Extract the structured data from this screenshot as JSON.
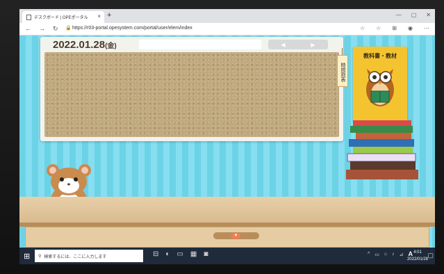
{
  "browser": {
    "tab_title": "デスクボード | OPEポータル",
    "tab_close": "×",
    "new_tab": "+",
    "window_controls": [
      "—",
      "▢",
      "✕"
    ],
    "nav_back": "←",
    "nav_forward": "→",
    "nav_refresh": "↻",
    "lock": "🔒",
    "url": "https://r03-portal.opesystem.com/portal/user/elem/index",
    "toolbar_icons": [
      "☆",
      "☆",
      "⊞",
      "◉",
      "⋯"
    ]
  },
  "page": {
    "date": "2022.01.28",
    "weekday": "(金)",
    "arrow_left": "◀",
    "arrow_right": "▶",
    "timetable_label": "時間割表",
    "textbook_label": "教科書・教材",
    "drawer_button": "▼"
  },
  "taskbar": {
    "start": "⊞",
    "search_icon": "⚲",
    "search_placeholder": "検索するには、ここに入力します",
    "apps": [
      "⊟",
      "◐",
      "▭",
      "▦",
      "◙"
    ],
    "tray": [
      "^",
      "▭",
      "⌂",
      "♪",
      "⊿"
    ],
    "ime": "A",
    "time": "4:01",
    "date": "2022/01/28",
    "notification": "▢"
  },
  "colors": {
    "wall_light": "#86def0",
    "wall_dark": "#6cd3e6",
    "board_frame": "#f3f3ee",
    "cork": "#c0a97f",
    "textbook": "#f4c430",
    "shelf": "#d9bb8f",
    "drawer_button": "#f07e52",
    "taskbar": "#1f2a3a"
  }
}
